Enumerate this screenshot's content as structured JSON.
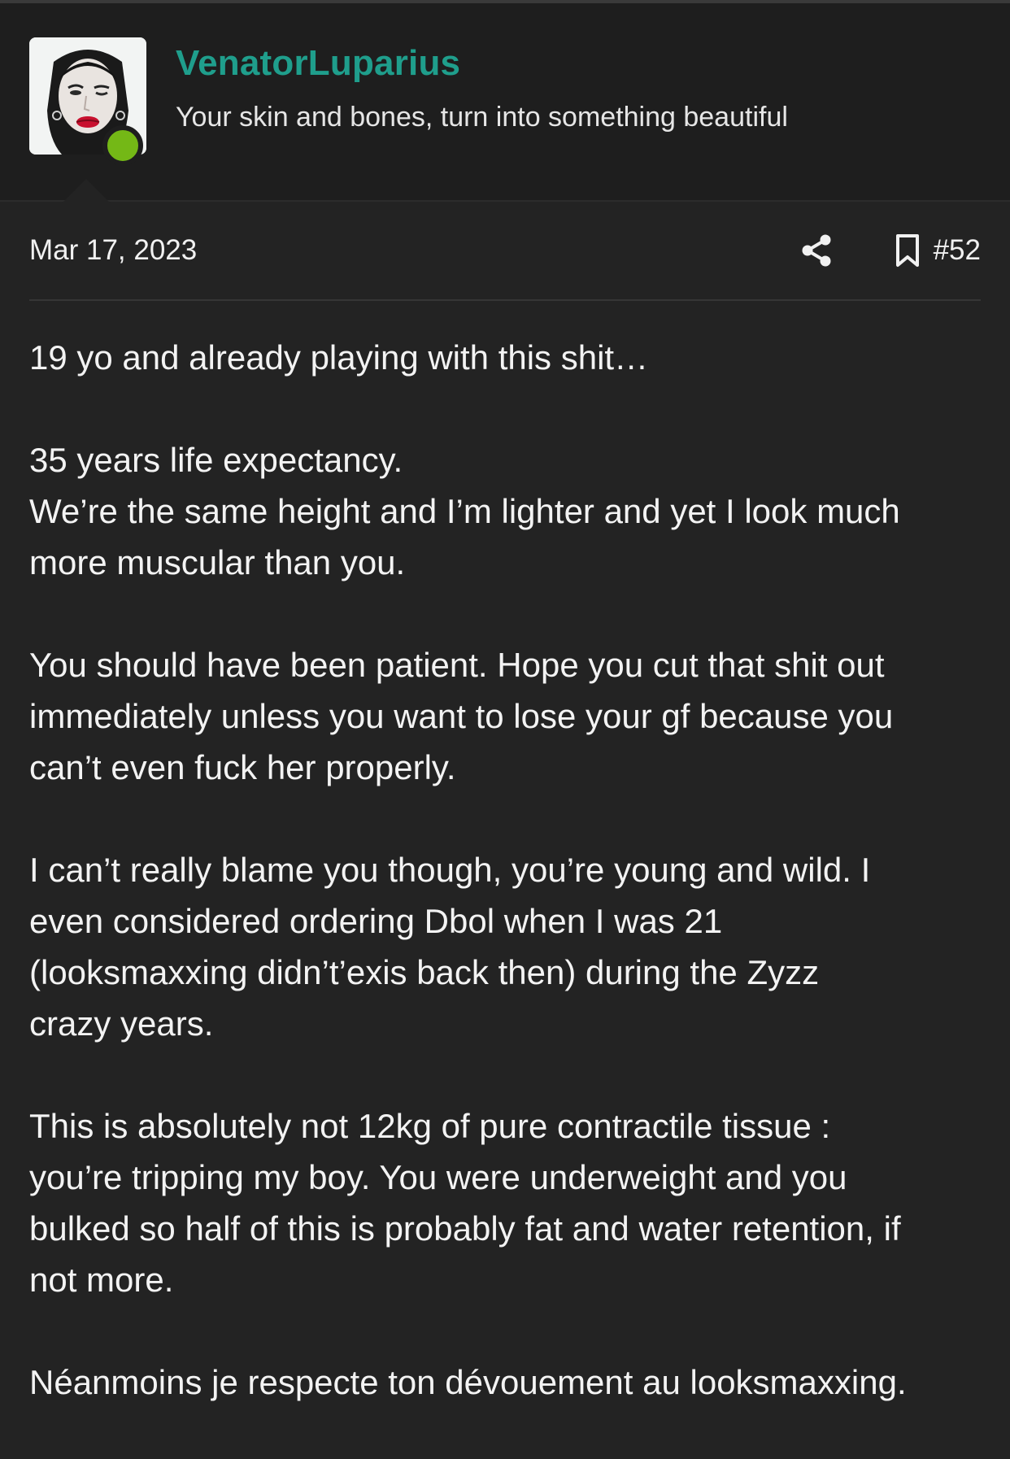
{
  "user": {
    "username": "VenatorLuparius",
    "title": "Your skin and bones, turn into something beautiful",
    "online": true,
    "username_color": "#1f9e8c",
    "online_color": "#74b816"
  },
  "post": {
    "date": "Mar 17, 2023",
    "number": "#52",
    "icons": [
      "share-icon",
      "bookmark-icon"
    ],
    "paragraphs": [
      [
        "19 yo and already playing with this shit…"
      ],
      [
        "35 years life expectancy.",
        "We’re the same height and I’m lighter and yet I look much",
        "more muscular than you."
      ],
      [
        "You should have been patient. Hope you cut that shit out",
        "immediately unless you want to lose your gf because you",
        "can’t even fuck her properly."
      ],
      [
        "I can’t really blame you though, you’re young and wild. I",
        "even considered ordering Dbol when I was 21",
        "(looksmaxxing didn’t’exis back then) during the Zyzz",
        "crazy years."
      ],
      [
        "This is absolutely not 12kg of pure contractile tissue :",
        "you’re tripping my boy. You were underweight and you",
        "bulked so half of this is probably fat and water retention, if",
        "not more."
      ],
      [
        "Néanmoins je respecte ton dévouement au looksmaxxing."
      ]
    ]
  }
}
